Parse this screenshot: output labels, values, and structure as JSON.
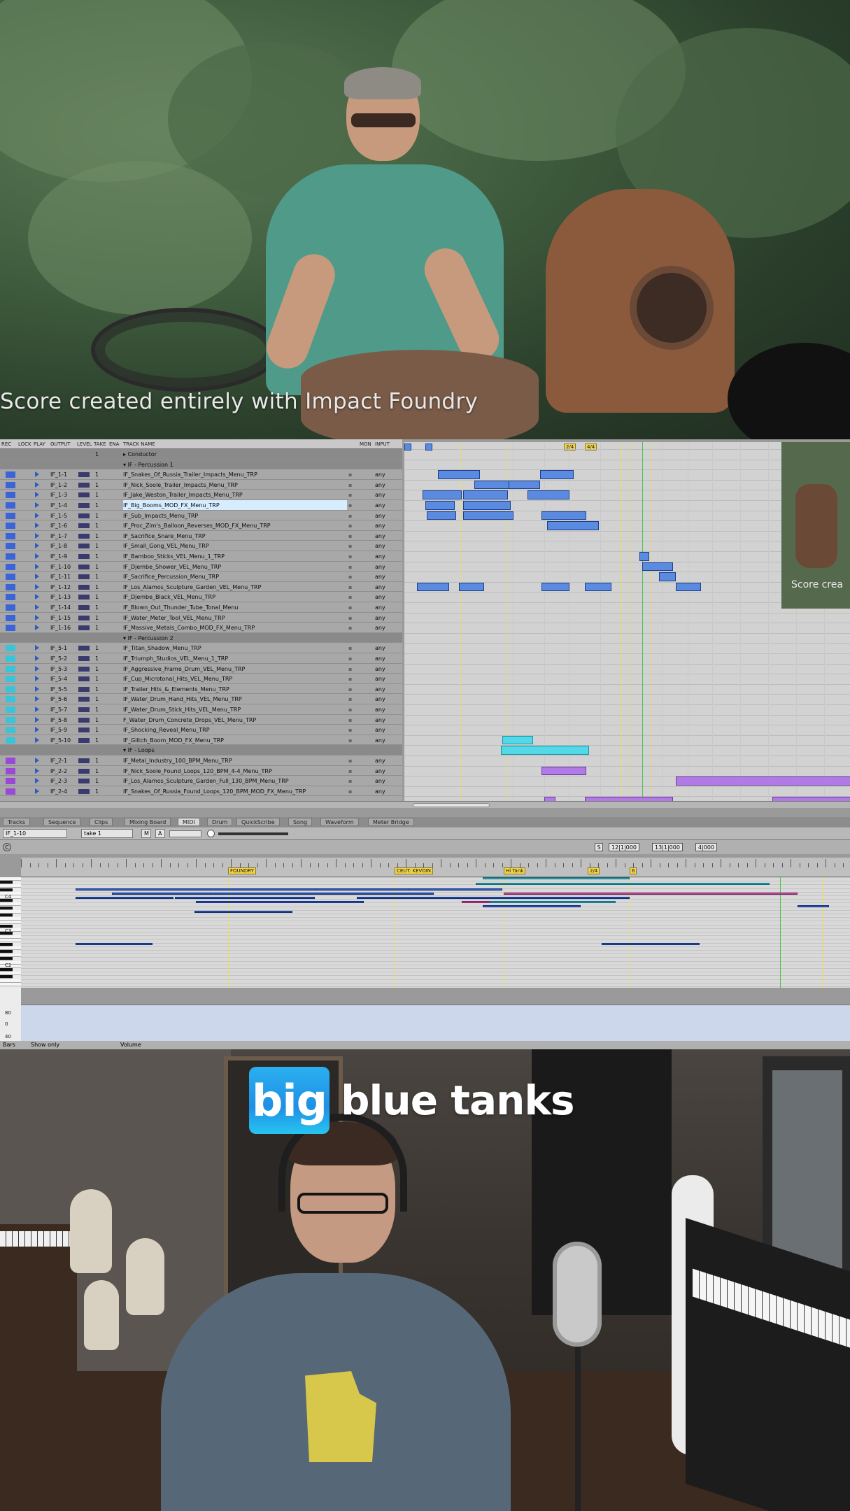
{
  "top_video": {
    "caption": "Score created entirely with Impact Foundry"
  },
  "daw": {
    "track_header": {
      "col_rec": "REC",
      "col_lock": "LOCK",
      "col_play": "PLAY",
      "col_output": "OUTPUT",
      "col_level": "LEVEL",
      "col_take": "TAKE",
      "col_ena": "ENA",
      "col_name": "TRACK NAME",
      "col_mon": "MON",
      "col_input": "INPUT"
    },
    "tracks": [
      {
        "kind": "conductor",
        "out": "",
        "take": "1",
        "name": "Conductor",
        "input": "",
        "color": ""
      },
      {
        "kind": "group",
        "out": "",
        "take": "",
        "name": "IF - Percussion 1",
        "input": "",
        "color": ""
      },
      {
        "kind": "track",
        "out": "IF_1-1",
        "take": "1",
        "name": "IF_Snakes_Of_Russia_Trailer_Impacts_Menu_TRP",
        "input": "any",
        "color": "#3a64d8"
      },
      {
        "kind": "track",
        "out": "IF_1-2",
        "take": "1",
        "name": "IF_Nick_Soole_Trailer_Impacts_Menu_TRP",
        "input": "any",
        "color": "#3a64d8"
      },
      {
        "kind": "track",
        "out": "IF_1-3",
        "take": "1",
        "name": "IF_Jake_Weston_Trailer_Impacts_Menu_TRP",
        "input": "any",
        "color": "#3a64d8"
      },
      {
        "kind": "track",
        "out": "IF_1-4",
        "take": "1",
        "name": "IF_Big_Booms_MOD_FX_Menu_TRP",
        "input": "any",
        "color": "#3a64d8",
        "selected": true
      },
      {
        "kind": "track",
        "out": "IF_1-5",
        "take": "1",
        "name": "IF_Sub_Impacts_Menu_TRP",
        "input": "any",
        "color": "#3a64d8"
      },
      {
        "kind": "track",
        "out": "IF_1-6",
        "take": "1",
        "name": "IF_Proc_Zim's_Balloon_Reverses_MOD_FX_Menu_TRP",
        "input": "any",
        "color": "#3a64d8"
      },
      {
        "kind": "track",
        "out": "IF_1-7",
        "take": "1",
        "name": "IF_Sacrifice_Snare_Menu_TRP",
        "input": "any",
        "color": "#3a64d8"
      },
      {
        "kind": "track",
        "out": "IF_1-8",
        "take": "1",
        "name": "IF_Small_Gong_VEL_Menu_TRP",
        "input": "any",
        "color": "#3a64d8"
      },
      {
        "kind": "track",
        "out": "IF_1-9",
        "take": "1",
        "name": "IF_Bamboo_Sticks_VEL_Menu_1_TRP",
        "input": "any",
        "color": "#3a64d8"
      },
      {
        "kind": "track",
        "out": "IF_1-10",
        "take": "1",
        "name": "IF_Djembe_Shower_VEL_Menu_TRP",
        "input": "any",
        "color": "#3a64d8"
      },
      {
        "kind": "track",
        "out": "IF_1-11",
        "take": "1",
        "name": "IF_Sacrifice_Percussion_Menu_TRP",
        "input": "any",
        "color": "#3a64d8"
      },
      {
        "kind": "track",
        "out": "IF_1-12",
        "take": "1",
        "name": "IF_Los_Alamos_Sculpture_Garden_VEL_Menu_TRP",
        "input": "any",
        "color": "#3a64d8"
      },
      {
        "kind": "track",
        "out": "IF_1-13",
        "take": "1",
        "name": "IF_Djembe_Black_VEL_Menu_TRP",
        "input": "any",
        "color": "#3a64d8"
      },
      {
        "kind": "track",
        "out": "IF_1-14",
        "take": "1",
        "name": "IF_Blown_Out_Thunder_Tube_Tonal_Menu",
        "input": "any",
        "color": "#3a64d8"
      },
      {
        "kind": "track",
        "out": "IF_1-15",
        "take": "1",
        "name": "IF_Water_Meter_Tool_VEL_Menu_TRP",
        "input": "any",
        "color": "#3a64d8"
      },
      {
        "kind": "track",
        "out": "IF_1-16",
        "take": "1",
        "name": "IF_Massive_Metals_Combo_MOD_FX_Menu_TRP",
        "input": "any",
        "color": "#3a64d8"
      },
      {
        "kind": "group",
        "out": "",
        "take": "",
        "name": "IF - Percussion 2",
        "input": "",
        "color": ""
      },
      {
        "kind": "track",
        "out": "IF_5-1",
        "take": "1",
        "name": "IF_Titan_Shadow_Menu_TRP",
        "input": "any",
        "color": "#36c6d8"
      },
      {
        "kind": "track",
        "out": "IF_5-2",
        "take": "1",
        "name": "IF_Triumph_Studios_VEL_Menu_1_TRP",
        "input": "any",
        "color": "#36c6d8"
      },
      {
        "kind": "track",
        "out": "IF_5-3",
        "take": "1",
        "name": "IF_Aggressive_Frame_Drum_VEL_Menu_TRP",
        "input": "any",
        "color": "#36c6d8"
      },
      {
        "kind": "track",
        "out": "IF_5-4",
        "take": "1",
        "name": "IF_Cup_Microtonal_Hits_VEL_Menu_TRP",
        "input": "any",
        "color": "#36c6d8"
      },
      {
        "kind": "track",
        "out": "IF_5-5",
        "take": "1",
        "name": "IF_Trailer_Hits_&_Elements_Menu_TRP",
        "input": "any",
        "color": "#36c6d8"
      },
      {
        "kind": "track",
        "out": "IF_5-6",
        "take": "1",
        "name": "IF_Water_Drum_Hand_Hits_VEL_Menu_TRP",
        "input": "any",
        "color": "#36c6d8"
      },
      {
        "kind": "track",
        "out": "IF_5-7",
        "take": "1",
        "name": "IF_Water_Drum_Stick_Hits_VEL_Menu_TRP",
        "input": "any",
        "color": "#36c6d8"
      },
      {
        "kind": "track",
        "out": "IF_5-8",
        "take": "1",
        "name": "F_Water_Drum_Concrete_Drops_VEL_Menu_TRP",
        "input": "any",
        "color": "#36c6d8"
      },
      {
        "kind": "track",
        "out": "IF_5-9",
        "take": "1",
        "name": "IF_Shocking_Reveal_Menu_TRP",
        "input": "any",
        "color": "#36c6d8"
      },
      {
        "kind": "track",
        "out": "IF_5-10",
        "take": "1",
        "name": "IF_Glitch_Boom_MOD_FX_Menu_TRP",
        "input": "any",
        "color": "#36c6d8"
      },
      {
        "kind": "group",
        "out": "",
        "take": "",
        "name": "IF - Loops",
        "input": "",
        "color": ""
      },
      {
        "kind": "track",
        "out": "IF_2-1",
        "take": "1",
        "name": "IF_Metal_Industry_100_BPM_Menu_TRP",
        "input": "any",
        "color": "#9a48d8"
      },
      {
        "kind": "track",
        "out": "IF_2-2",
        "take": "1",
        "name": "IF_Nick_Soole_Found_Loops_120_BPM_4-4_Menu_TRP",
        "input": "any",
        "color": "#9a48d8"
      },
      {
        "kind": "track",
        "out": "IF_2-3",
        "take": "1",
        "name": "IF_Los_Alamos_Sculpture_Garden_Full_130_BPM_Menu_TRP",
        "input": "any",
        "color": "#9a48d8"
      },
      {
        "kind": "track",
        "out": "IF_2-4",
        "take": "1",
        "name": "IF_Snakes_Of_Russia_Found_Loops_120_BPM_MOD_FX_Menu_TRP",
        "input": "any",
        "color": "#9a48d8"
      }
    ],
    "meter_markers": [
      "2/4",
      "4/4"
    ],
    "overlay_caption": "Score crea",
    "tabs": [
      "Tracks",
      "Sequence",
      "Clips",
      "Mixing Board",
      "MIDI",
      "Drum",
      "QuickScribe",
      "Song",
      "Waveform",
      "Meter Bridge"
    ],
    "active_tab": "MIDI",
    "midi_toolbar": {
      "track_select": "IF_1-10",
      "take_select": "take 1",
      "m_label": "M",
      "a_label": "A",
      "position_1": "12|1|000",
      "position_2": "13|1|000",
      "position_3": "4|000",
      "s_label": "S",
      "c_label": "C"
    },
    "markers": [
      "FOUNDRY",
      "CEUT: KEVOIN",
      "Hi Tank",
      "2/4",
      "6"
    ],
    "piano_labels": [
      "C4",
      "C3",
      "C2"
    ],
    "velocity_labels": [
      "80",
      "0",
      "40"
    ],
    "status_bar": {
      "bars": "Bars",
      "show": "Show only",
      "volume": "Volume"
    }
  },
  "brand": {
    "logo_word1": "big",
    "logo_word2": "blue tanks"
  },
  "colors": {
    "clip_blue": "#5b8be0",
    "clip_teal": "#52d8e6",
    "clip_purple": "#b27ae6",
    "logo_blue": "#1f8fe6"
  }
}
